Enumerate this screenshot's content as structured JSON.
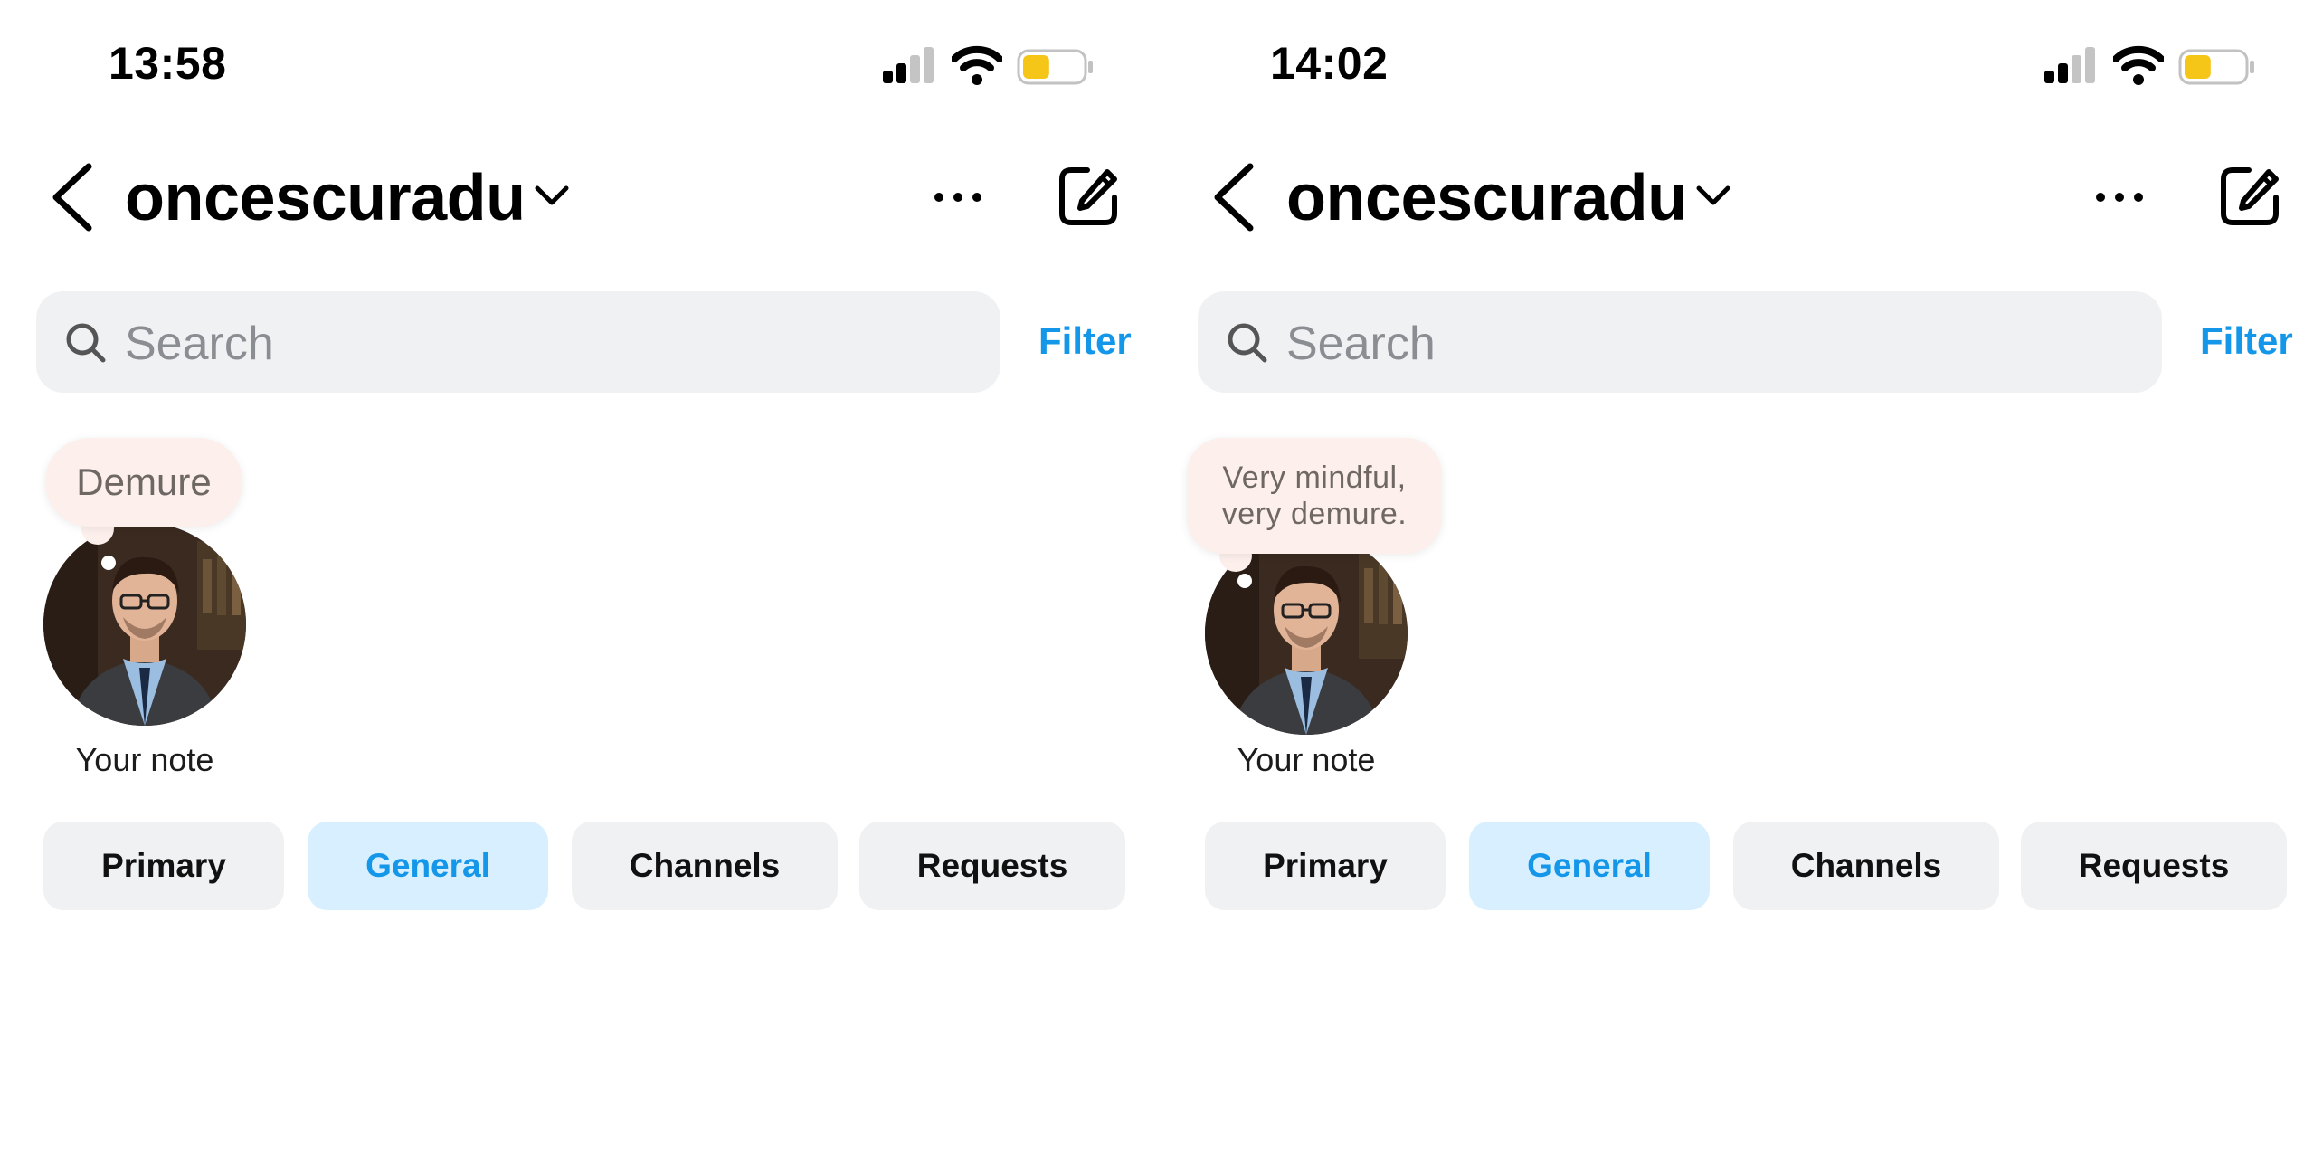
{
  "colors": {
    "accent": "#1497e8",
    "active_tab_bg": "#d7efff",
    "note_bubble_bg": "#fcefec",
    "battery_fill": "#f5c518"
  },
  "panels": [
    {
      "status_bar": {
        "time": "13:58",
        "battery_level": 0.45
      },
      "header": {
        "username": "oncescuradu",
        "icons": [
          "back-chevron-icon",
          "chevron-down-icon",
          "more-icon",
          "compose-icon"
        ]
      },
      "search": {
        "placeholder": "Search",
        "filter_label": "Filter"
      },
      "note": {
        "text": "Demure",
        "label": "Your note"
      },
      "tabs": [
        {
          "label": "Primary",
          "active": false
        },
        {
          "label": "General",
          "active": true
        },
        {
          "label": "Channels",
          "active": false
        },
        {
          "label": "Requests",
          "active": false
        }
      ]
    },
    {
      "status_bar": {
        "time": "14:02",
        "battery_level": 0.45
      },
      "header": {
        "username": "oncescuradu",
        "icons": [
          "back-chevron-icon",
          "chevron-down-icon",
          "more-icon",
          "compose-icon"
        ]
      },
      "search": {
        "placeholder": "Search",
        "filter_label": "Filter"
      },
      "note": {
        "text": "Very mindful,\nvery demure.",
        "label": "Your note"
      },
      "tabs": [
        {
          "label": "Primary",
          "active": false
        },
        {
          "label": "General",
          "active": true
        },
        {
          "label": "Channels",
          "active": false
        },
        {
          "label": "Requests",
          "active": false
        }
      ]
    }
  ]
}
